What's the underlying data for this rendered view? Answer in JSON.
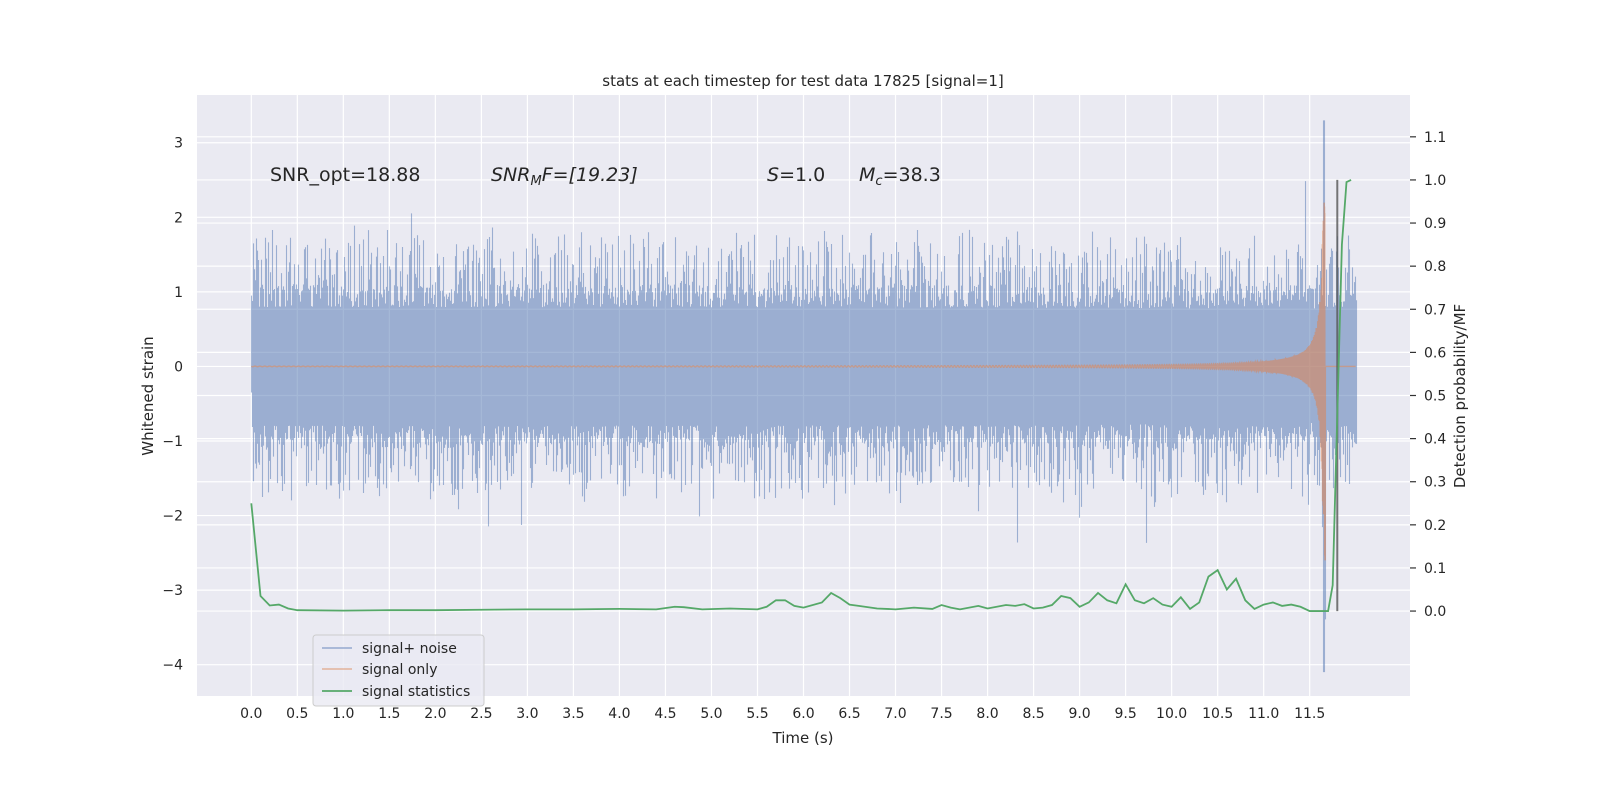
{
  "chart_data": {
    "type": "line",
    "title": "stats at each timestep for test data 17825 [signal=1]",
    "xlabel": "Time (s)",
    "ylabel_left": "Whitened strain",
    "ylabel_right": "Detection probability/MF",
    "xlim": [
      -0.59,
      12.59
    ],
    "ylim_left": [
      -4.42,
      3.64
    ],
    "ylim_right": [
      -0.197,
      1.197
    ],
    "grid": true,
    "legend_position": "lower-left",
    "x_ticks": [
      "0.0",
      "0.5",
      "1.0",
      "1.5",
      "2.0",
      "2.5",
      "3.0",
      "3.5",
      "4.0",
      "4.5",
      "5.0",
      "5.5",
      "6.0",
      "6.5",
      "7.0",
      "7.5",
      "8.0",
      "8.5",
      "9.0",
      "9.5",
      "10.0",
      "10.5",
      "11.0",
      "11.5"
    ],
    "y_ticks_left": [
      "3",
      "2",
      "1",
      "0",
      "−1",
      "−2",
      "−3",
      "−4"
    ],
    "y_ticks_right": [
      "1.1",
      "1.0",
      "0.9",
      "0.8",
      "0.7",
      "0.6",
      "0.5",
      "0.4",
      "0.3",
      "0.2",
      "0.1",
      "0.0"
    ],
    "annotations": {
      "snr_opt": "SNR_opt=18.88",
      "snr_mf_main": "SNR",
      "snr_mf_sub": "M",
      "snr_mf_rest": "F=[19.23]",
      "s_main": "S",
      "s_rest": "=1.0",
      "mc_main": "M",
      "mc_sub": "c",
      "mc_rest": "=38.3"
    },
    "series": [
      {
        "name": "signal+ noise",
        "color": "#4c72b0",
        "axis": "left",
        "t_range": [
          0,
          12.0
        ],
        "max": 3.3,
        "min": -4.1,
        "peak_time": 11.65
      },
      {
        "name": "signal only",
        "color": "#dd8452",
        "axis": "left",
        "t_range": [
          0,
          12.0
        ],
        "peak_amplitude": 3.0,
        "merger_time": 11.67
      },
      {
        "name": "signal statistics",
        "color": "#55a868",
        "axis": "right",
        "x": [
          0.0,
          0.1,
          0.2,
          0.3,
          0.4,
          0.5,
          1.0,
          1.5,
          2.0,
          2.5,
          3.0,
          3.5,
          4.0,
          4.4,
          4.6,
          4.7,
          4.9,
          5.2,
          5.5,
          5.6,
          5.7,
          5.8,
          5.9,
          6.0,
          6.2,
          6.3,
          6.4,
          6.5,
          6.6,
          6.8,
          7.0,
          7.2,
          7.4,
          7.5,
          7.6,
          7.7,
          7.9,
          8.0,
          8.2,
          8.3,
          8.4,
          8.5,
          8.6,
          8.7,
          8.8,
          8.9,
          9.0,
          9.1,
          9.2,
          9.3,
          9.4,
          9.5,
          9.6,
          9.7,
          9.8,
          9.9,
          10.0,
          10.1,
          10.2,
          10.3,
          10.4,
          10.5,
          10.6,
          10.7,
          10.8,
          10.9,
          11.0,
          11.1,
          11.2,
          11.3,
          11.4,
          11.5,
          11.6,
          11.7,
          11.75,
          11.85,
          11.9,
          11.95
        ],
        "y": [
          0.25,
          0.035,
          0.013,
          0.015,
          0.006,
          0.002,
          0.001,
          0.002,
          0.002,
          0.003,
          0.004,
          0.004,
          0.005,
          0.004,
          0.01,
          0.009,
          0.004,
          0.006,
          0.004,
          0.01,
          0.025,
          0.025,
          0.012,
          0.008,
          0.02,
          0.042,
          0.03,
          0.015,
          0.012,
          0.006,
          0.004,
          0.008,
          0.005,
          0.014,
          0.008,
          0.004,
          0.012,
          0.006,
          0.014,
          0.012,
          0.016,
          0.006,
          0.008,
          0.014,
          0.035,
          0.03,
          0.01,
          0.02,
          0.042,
          0.025,
          0.018,
          0.062,
          0.025,
          0.018,
          0.03,
          0.015,
          0.01,
          0.032,
          0.005,
          0.02,
          0.08,
          0.095,
          0.05,
          0.075,
          0.025,
          0.005,
          0.015,
          0.02,
          0.012,
          0.015,
          0.01,
          0.0,
          0.0,
          0.0,
          0.06,
          0.85,
          0.995,
          1.0
        ]
      },
      {
        "name": "",
        "color": "#555555",
        "axis": "right",
        "type": "vline",
        "x": 11.8,
        "y": [
          0.0,
          1.0
        ]
      }
    ]
  }
}
